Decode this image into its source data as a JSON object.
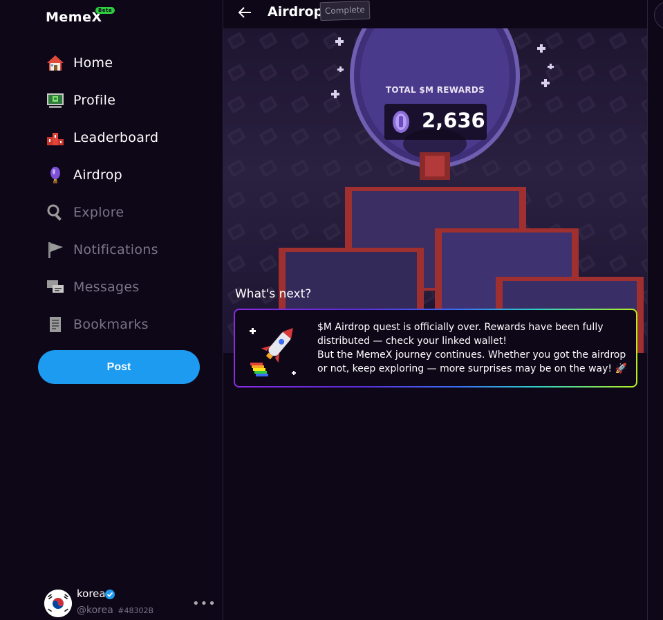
{
  "app": {
    "logo_text": "MemeX",
    "logo_badge": "Beta"
  },
  "sidebar": {
    "items": [
      {
        "label": "Home",
        "icon": "home-icon"
      },
      {
        "label": "Profile",
        "icon": "profile-icon"
      },
      {
        "label": "Leaderboard",
        "icon": "leaderboard-icon"
      },
      {
        "label": "Airdrop",
        "icon": "airdrop-icon"
      },
      {
        "label": "Explore",
        "icon": "search-icon"
      },
      {
        "label": "Notifications",
        "icon": "flag-icon"
      },
      {
        "label": "Messages",
        "icon": "messages-icon"
      },
      {
        "label": "Bookmarks",
        "icon": "bookmarks-icon"
      }
    ],
    "post_label": "Post"
  },
  "user": {
    "name": "korea",
    "handle": "@korea",
    "id": "#48302B",
    "avatar": "korea-flag-avatar"
  },
  "header": {
    "title": "Airdrop",
    "badge": "Complete"
  },
  "rewards": {
    "label": "TOTAL $M REWARDS",
    "value": "2,636"
  },
  "next": {
    "title": "What's next?",
    "line1": "$M Airdrop quest is officially over. Rewards have been fully distributed — check your linked wallet!",
    "line2": "But the MemeX journey continues. Whether you got the airdrop or not, keep exploring — more surprises may be on the way! 🚀"
  },
  "colors": {
    "background": "#0e0718",
    "accent": "#1d9bf0",
    "dim_text": "#7a7486"
  }
}
